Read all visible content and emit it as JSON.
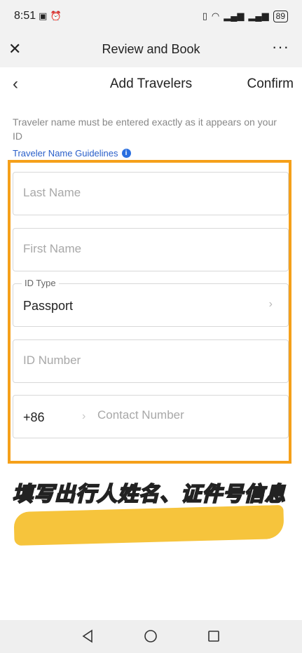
{
  "status_bar": {
    "time": "8:51",
    "battery": "89"
  },
  "top_bar": {
    "title": "Review and Book"
  },
  "nav_bar": {
    "title": "Add Travelers",
    "confirm_label": "Confirm"
  },
  "notice": "Traveler name must be entered exactly as it appears on your ID",
  "guidelines_link": "Traveler Name Guidelines",
  "form": {
    "last_name": {
      "placeholder": "Last Name",
      "value": ""
    },
    "first_name": {
      "placeholder": "First Name",
      "value": ""
    },
    "id_type": {
      "label": "ID Type",
      "value": "Passport"
    },
    "id_number": {
      "placeholder": "ID Number",
      "value": ""
    },
    "contact": {
      "country_code": "+86",
      "placeholder": "Contact Number",
      "value": ""
    }
  },
  "caption": "填写出行人姓名、证件号信息",
  "colors": {
    "highlight": "#f5a01a",
    "link": "#2a5fc9",
    "brush": "#f6c43c"
  },
  "icons": [
    "close-icon",
    "more-icon",
    "back-icon",
    "info-icon",
    "chevron-right-icon",
    "nav-back-icon",
    "nav-home-icon",
    "nav-recents-icon"
  ]
}
